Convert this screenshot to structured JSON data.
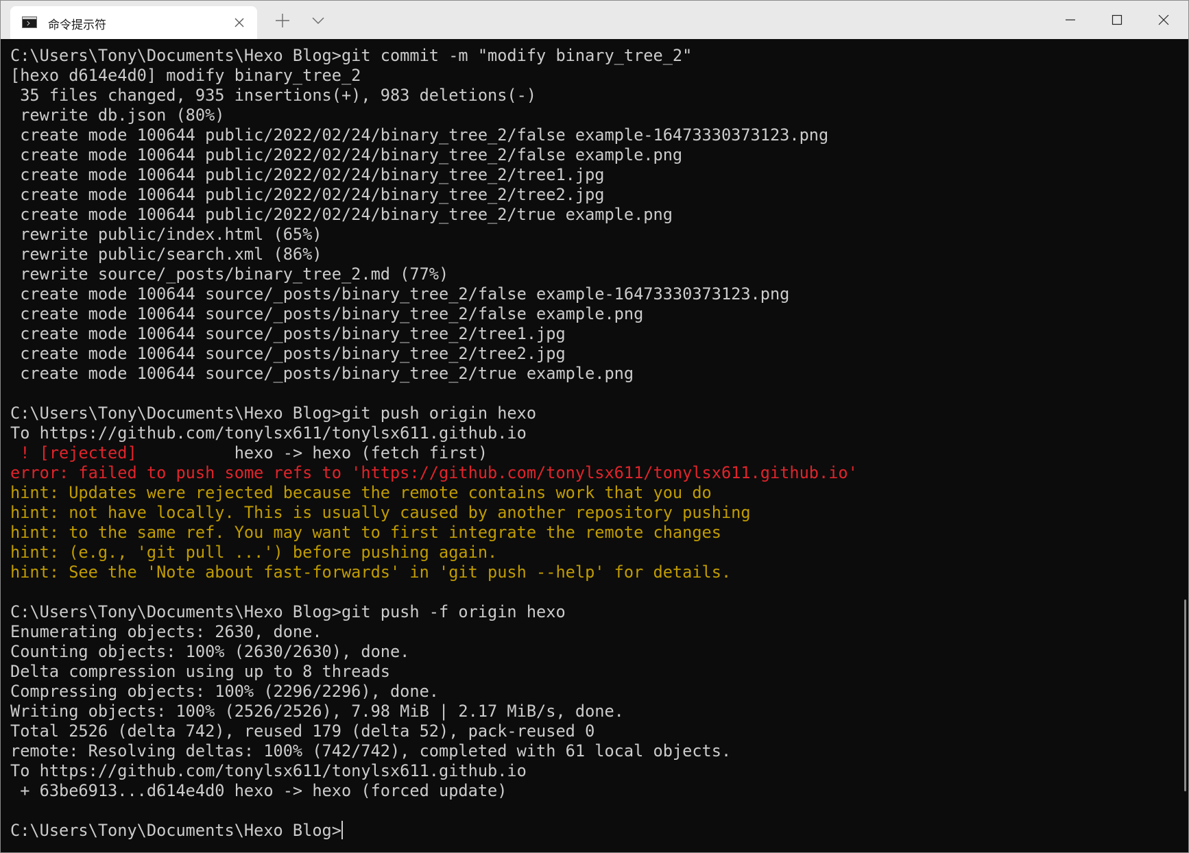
{
  "window": {
    "tab_title": "命令提示符",
    "tab_icon": "cmd-terminal-icon",
    "controls": [
      "minimize-icon",
      "maximize-icon",
      "close-icon"
    ]
  },
  "colors": {
    "background": "#0c0c0c",
    "text": "#cccccc",
    "error": "#e0242b",
    "hint": "#c19c00"
  },
  "terminal": {
    "lines": [
      {
        "text": "C:\\Users\\Tony\\Documents\\Hexo Blog>git commit -m \"modify binary_tree_2\"",
        "style": "normal"
      },
      {
        "text": "[hexo d614e4d0] modify binary_tree_2",
        "style": "normal"
      },
      {
        "text": " 35 files changed, 935 insertions(+), 983 deletions(-)",
        "style": "normal"
      },
      {
        "text": " rewrite db.json (80%)",
        "style": "normal"
      },
      {
        "text": " create mode 100644 public/2022/02/24/binary_tree_2/false example-16473330373123.png",
        "style": "normal"
      },
      {
        "text": " create mode 100644 public/2022/02/24/binary_tree_2/false example.png",
        "style": "normal"
      },
      {
        "text": " create mode 100644 public/2022/02/24/binary_tree_2/tree1.jpg",
        "style": "normal"
      },
      {
        "text": " create mode 100644 public/2022/02/24/binary_tree_2/tree2.jpg",
        "style": "normal"
      },
      {
        "text": " create mode 100644 public/2022/02/24/binary_tree_2/true example.png",
        "style": "normal"
      },
      {
        "text": " rewrite public/index.html (65%)",
        "style": "normal"
      },
      {
        "text": " rewrite public/search.xml (86%)",
        "style": "normal"
      },
      {
        "text": " rewrite source/_posts/binary_tree_2.md (77%)",
        "style": "normal"
      },
      {
        "text": " create mode 100644 source/_posts/binary_tree_2/false example-16473330373123.png",
        "style": "normal"
      },
      {
        "text": " create mode 100644 source/_posts/binary_tree_2/false example.png",
        "style": "normal"
      },
      {
        "text": " create mode 100644 source/_posts/binary_tree_2/tree1.jpg",
        "style": "normal"
      },
      {
        "text": " create mode 100644 source/_posts/binary_tree_2/tree2.jpg",
        "style": "normal"
      },
      {
        "text": " create mode 100644 source/_posts/binary_tree_2/true example.png",
        "style": "normal"
      },
      {
        "text": "",
        "style": "normal"
      },
      {
        "text": "C:\\Users\\Tony\\Documents\\Hexo Blog>git push origin hexo",
        "style": "normal"
      },
      {
        "text": "To https://github.com/tonylsx611/tonylsx611.github.io",
        "style": "normal"
      },
      {
        "text": "",
        "style": "split",
        "red": " ! [rejected]",
        "rest": "          hexo -> hexo (fetch first)"
      },
      {
        "text": "error: failed to push some refs to 'https://github.com/tonylsx611/tonylsx611.github.io'",
        "style": "red"
      },
      {
        "text": "hint: Updates were rejected because the remote contains work that you do",
        "style": "yellow"
      },
      {
        "text": "hint: not have locally. This is usually caused by another repository pushing",
        "style": "yellow"
      },
      {
        "text": "hint: to the same ref. You may want to first integrate the remote changes",
        "style": "yellow"
      },
      {
        "text": "hint: (e.g., 'git pull ...') before pushing again.",
        "style": "yellow"
      },
      {
        "text": "hint: See the 'Note about fast-forwards' in 'git push --help' for details.",
        "style": "yellow"
      },
      {
        "text": "",
        "style": "normal"
      },
      {
        "text": "C:\\Users\\Tony\\Documents\\Hexo Blog>git push -f origin hexo",
        "style": "normal"
      },
      {
        "text": "Enumerating objects: 2630, done.",
        "style": "normal"
      },
      {
        "text": "Counting objects: 100% (2630/2630), done.",
        "style": "normal"
      },
      {
        "text": "Delta compression using up to 8 threads",
        "style": "normal"
      },
      {
        "text": "Compressing objects: 100% (2296/2296), done.",
        "style": "normal"
      },
      {
        "text": "Writing objects: 100% (2526/2526), 7.98 MiB | 2.17 MiB/s, done.",
        "style": "normal"
      },
      {
        "text": "Total 2526 (delta 742), reused 179 (delta 52), pack-reused 0",
        "style": "normal"
      },
      {
        "text": "remote: Resolving deltas: 100% (742/742), completed with 61 local objects.",
        "style": "normal"
      },
      {
        "text": "To https://github.com/tonylsx611/tonylsx611.github.io",
        "style": "normal"
      },
      {
        "text": " + 63be6913...d614e4d0 hexo -> hexo (forced update)",
        "style": "normal"
      },
      {
        "text": "",
        "style": "normal"
      }
    ],
    "prompt": "C:\\Users\\Tony\\Documents\\Hexo Blog>"
  }
}
